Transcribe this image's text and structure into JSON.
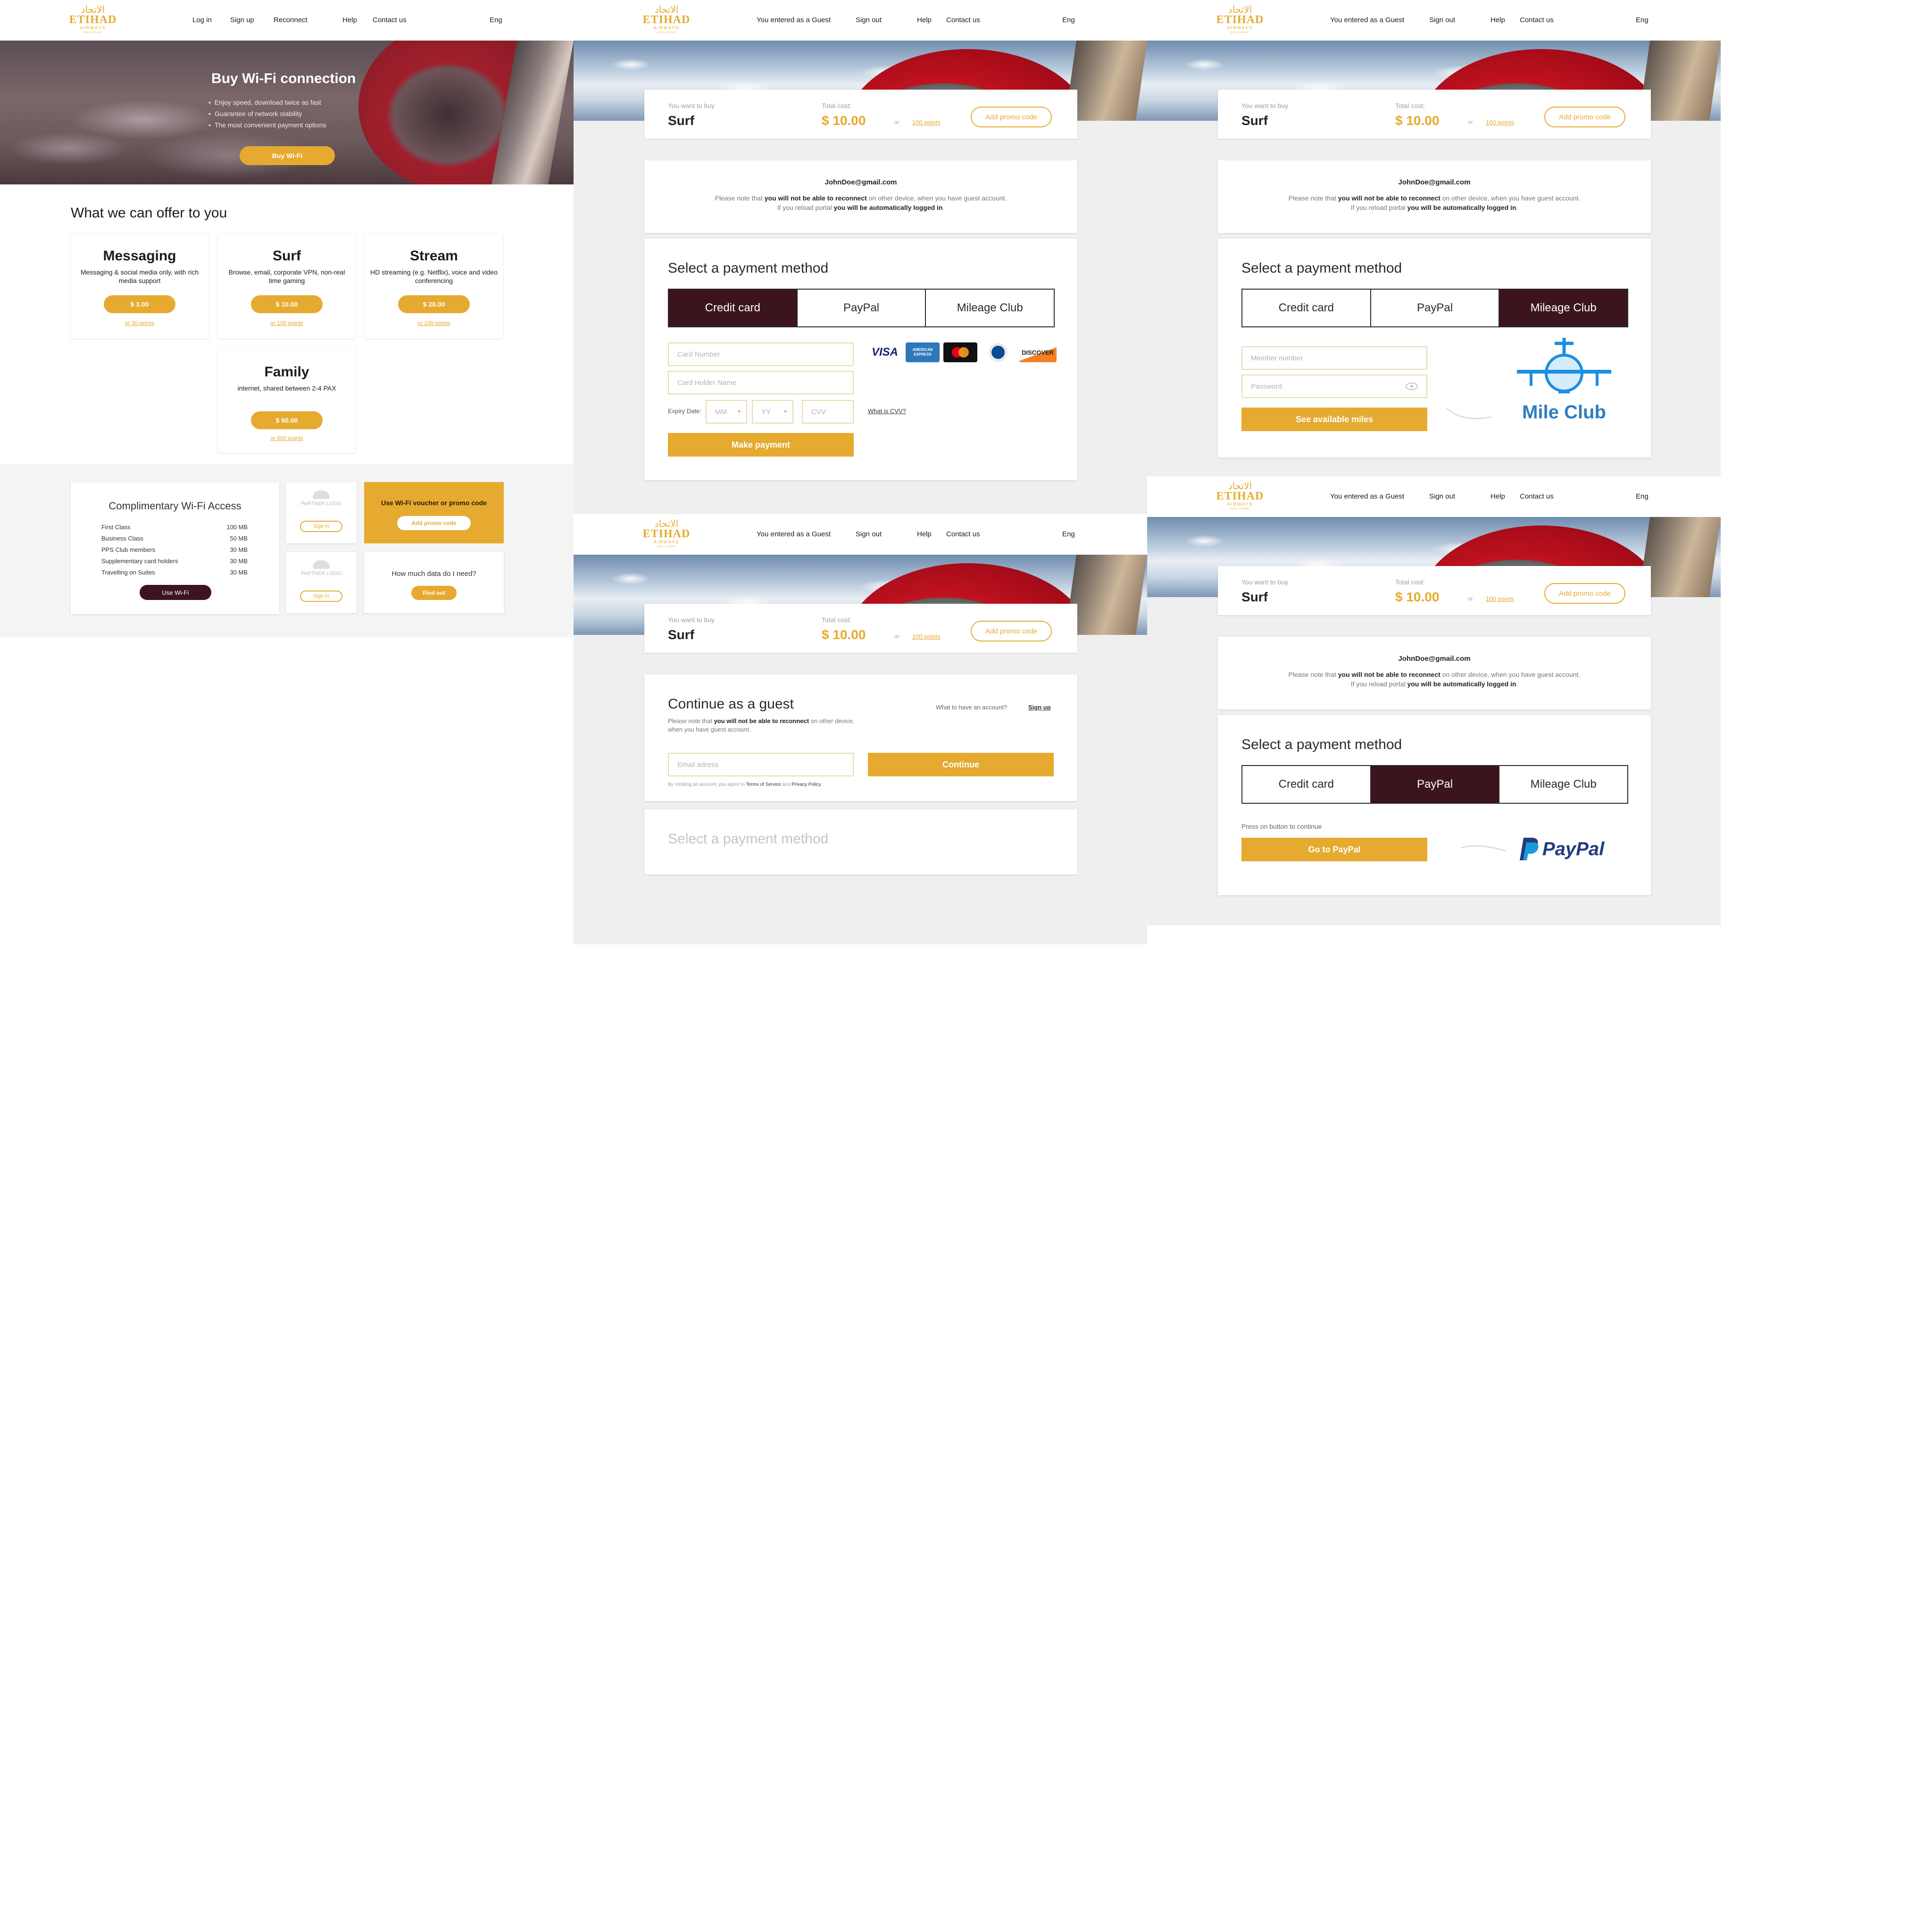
{
  "brand": {
    "logo_arabic": "الاتحاد",
    "logo_main": "ETIHAD",
    "logo_sub": "AIRWAYS",
    "logo_tag": "ABU DHABI",
    "gold": "#e5aa2f",
    "dark": "#3b141e"
  },
  "home": {
    "nav": {
      "login": "Log in",
      "signup": "Sign up",
      "reconnect": "Reconnect",
      "help": "Help",
      "contact": "Contact us",
      "lang": "Eng"
    },
    "hero": {
      "title": "Buy Wi-Fi connection",
      "bullets": [
        "Enjoy speed, download twice as fast",
        "Guarantee of network stability",
        "The most convenient payment options"
      ],
      "button": "Buy Wi-Fi"
    },
    "offers_title": "What we can offer to you",
    "plans": [
      {
        "name": "Messaging",
        "desc": "Messaging & social media only, with rich media support",
        "price": "$ 3.00",
        "points": "or 30 points"
      },
      {
        "name": "Surf",
        "desc": "Browse, email, corporate VPN, non-real time gaming",
        "price": "$ 10.00",
        "points": "or 100 points"
      },
      {
        "name": "Stream",
        "desc": "HD streaming (e.g. Netflix), voice and video conferencing",
        "price": "$ 20.00",
        "points": "or 200 points"
      },
      {
        "name": "Family",
        "desc": "internet, shared between 2-4 PAX",
        "price": "$ 60.00",
        "points": "or 600 points"
      }
    ],
    "complimentary": {
      "title": "Complimentary Wi-Fi Access",
      "rows": [
        {
          "label": "First Class",
          "value": "100 MB"
        },
        {
          "label": "Business Class",
          "value": "50 MB"
        },
        {
          "label": "PPS Club members",
          "value": "30 MB"
        },
        {
          "label": "Supplementary card holders",
          "value": "30 MB"
        },
        {
          "label": "Travelling on Suites",
          "value": "30 MB"
        }
      ],
      "button": "Use Wi-Fi"
    },
    "partner": {
      "logo_text": "PARTNER LOGO",
      "signin": "Sign in"
    },
    "voucher": {
      "title": "Use Wi-Fi voucher or promo code",
      "button": "Add promo code"
    },
    "data_need": {
      "title": "How much data do I need?",
      "button": "Find out"
    }
  },
  "guest_nav": {
    "status": "You entered as a Guest",
    "signout": "Sign out",
    "help": "Help",
    "contact": "Contact us",
    "lang": "Eng"
  },
  "summary": {
    "want_label": "You want to buy",
    "product": "Surf",
    "cost_label": "Total cost:",
    "price": "$ 10.00",
    "or": "or",
    "points": "100 points",
    "promo_button": "Add promo code"
  },
  "account": {
    "email": "JohnDoe@gmail.com",
    "note1_a": "Please note that ",
    "note1_b": "you will not be able to reconnect",
    "note1_c": " on other device, when you have guest account.",
    "note2_a": "If you reload portal ",
    "note2_b": "you will be automatically logged in",
    "note2_c": "."
  },
  "payment": {
    "title": "Select a payment method",
    "tabs": [
      "Credit card",
      "PayPal",
      "Mileage Club"
    ],
    "credit": {
      "card_number": "Card Number",
      "holder": "Card Holder Name",
      "expiry_label": "Expiry Date:",
      "mm": "MM",
      "yy": "YY",
      "cvv": "CVV",
      "cvv_link": "What is CVV?",
      "button": "Make payment",
      "logos": [
        "VISA",
        "AMERICAN EXPRESS",
        "mastercard",
        "Diners Club",
        "DISCOVER"
      ]
    },
    "mileage": {
      "member": "Member number",
      "password": "Password",
      "button": "See available miles",
      "logo_text": "Mile Club"
    },
    "paypal": {
      "hint": "Press on button to continue",
      "button": "Go to PayPal",
      "logo_text": "PayPal"
    }
  },
  "guest": {
    "title": "Continue as a guest",
    "note_a": "Please note that ",
    "note_b": "you will not be able to reconnect",
    "note_c": " on other device, when you have guest account.",
    "account_q": "What to have an account?",
    "signup": "Sign up",
    "email_placeholder": "Email adress",
    "continue": "Continue",
    "terms_a": "By creating an account, you agree to ",
    "terms_b": "Terms of Service",
    "terms_c": " and ",
    "terms_d": "Privacy Policy",
    "terms_e": "."
  }
}
